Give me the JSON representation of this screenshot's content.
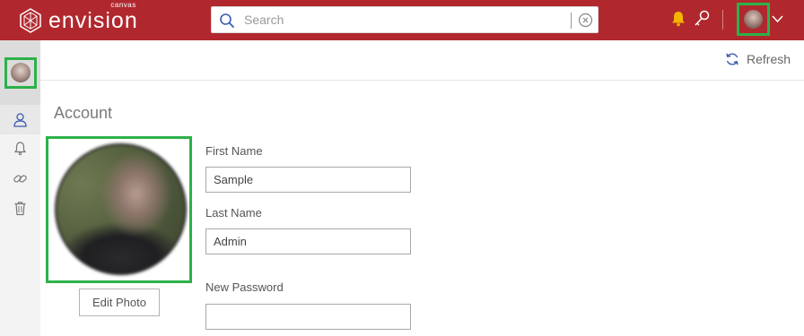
{
  "brand": {
    "name": "envision",
    "sub": "canvas",
    "color": "#b0282e"
  },
  "search": {
    "placeholder": "Search",
    "value": ""
  },
  "toolbar": {
    "refresh_label": "Refresh"
  },
  "account": {
    "title": "Account",
    "edit_photo_label": "Edit Photo",
    "fields": {
      "first_name": {
        "label": "First Name",
        "value": "Sample"
      },
      "last_name": {
        "label": "Last Name",
        "value": "Admin"
      },
      "new_password": {
        "label": "New Password",
        "value": ""
      }
    }
  },
  "sidebar": {
    "items": [
      {
        "icon": "user-icon",
        "active": true
      },
      {
        "icon": "bell-icon",
        "active": false
      },
      {
        "icon": "link-icon",
        "active": false
      },
      {
        "icon": "trash-icon",
        "active": false
      }
    ]
  },
  "colors": {
    "highlight": "#2db14a",
    "notification": "#f5b301"
  }
}
